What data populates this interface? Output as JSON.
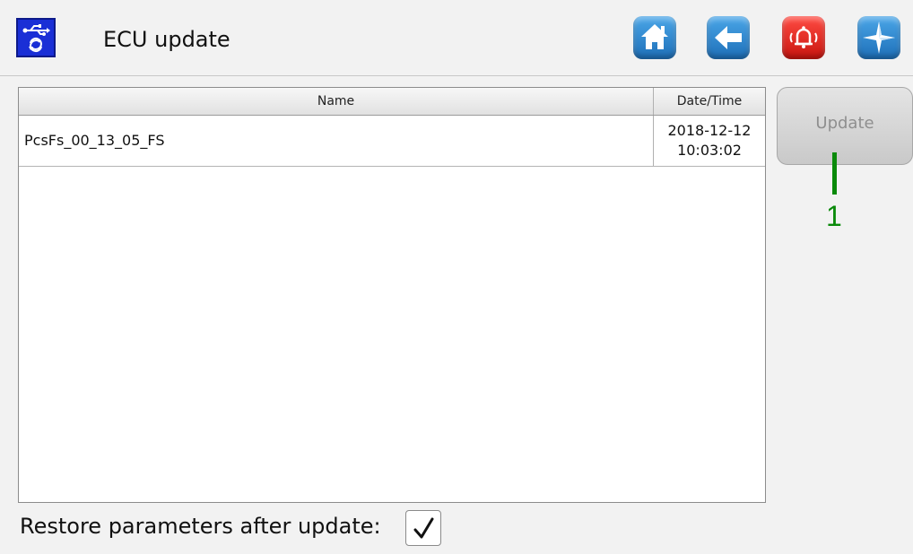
{
  "header": {
    "title": "ECU update",
    "app_icon": "usb-update-icon",
    "nav": [
      {
        "name": "home",
        "icon": "home-icon",
        "color": "#2a86d3"
      },
      {
        "name": "back",
        "icon": "arrow-left-icon",
        "color": "#2a86d3"
      },
      {
        "name": "alarm",
        "icon": "alarm-bell-icon",
        "color": "#e0241c"
      },
      {
        "name": "navigation",
        "icon": "compass-star-icon",
        "color": "#2a86d3"
      }
    ]
  },
  "table": {
    "columns": [
      "Name",
      "Date/Time"
    ],
    "rows": [
      {
        "name": "PcsFs_00_13_05_FS",
        "date": "2018-12-12",
        "time": "10:03:02"
      }
    ]
  },
  "update": {
    "label": "Update",
    "enabled": false
  },
  "callout": {
    "label": "1",
    "color": "#0a8a0a"
  },
  "restore": {
    "label": "Restore parameters after update:",
    "checked": true
  }
}
